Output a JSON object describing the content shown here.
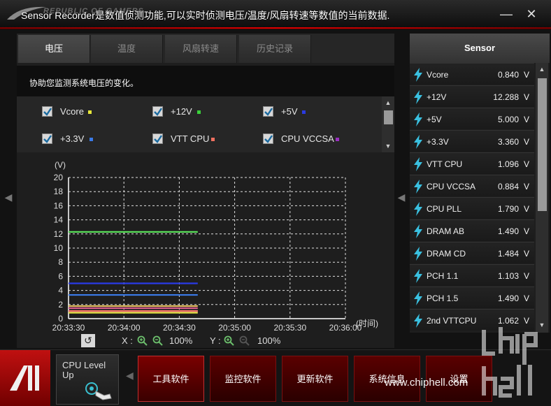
{
  "titlebar": {
    "logo_text": "REPUBLIC OF GAMERS",
    "title": "Sensor Recorder是数值侦测功能,可以实时侦测电压/温度/风扇转速等数值的当前数据.",
    "minimize": "—",
    "close": "✕"
  },
  "tabs": [
    {
      "label": "电压",
      "active": true
    },
    {
      "label": "温度",
      "active": false
    },
    {
      "label": "风扇转速",
      "active": false
    },
    {
      "label": "历史记录",
      "active": false
    }
  ],
  "description": "协助您监测系统电压的变化。",
  "checks": [
    {
      "label": "Vcore",
      "checked": true,
      "color": "#e8e83a"
    },
    {
      "label": "+12V",
      "checked": true,
      "color": "#3ad03a"
    },
    {
      "label": "+5V",
      "checked": true,
      "color": "#2a3ae0"
    },
    {
      "label": "+3.3V",
      "checked": true,
      "color": "#3a7ae8"
    },
    {
      "label": "VTT CPU",
      "checked": true,
      "color": "#f07060"
    },
    {
      "label": "CPU VCCSA",
      "checked": true,
      "color": "#9a30c0"
    }
  ],
  "chart_data": {
    "type": "line",
    "ylabel": "(V)",
    "xlabel": "(时间)",
    "ylim": [
      0,
      20
    ],
    "yticks": [
      0,
      2,
      4,
      6,
      8,
      10,
      12,
      14,
      16,
      18,
      20
    ],
    "xticks": [
      "20:33:30",
      "20:34:00",
      "20:34:30",
      "20:35:00",
      "20:35:30",
      "20:36:00"
    ],
    "x_range": [
      "20:33:30",
      "20:36:00"
    ],
    "grid": true,
    "series": [
      {
        "name": "+12V",
        "color": "#5ae05a",
        "x": [
          "20:33:30",
          "20:34:40"
        ],
        "y": [
          12.288,
          12.288
        ]
      },
      {
        "name": "+5V",
        "color": "#2a3ae8",
        "x": [
          "20:33:30",
          "20:34:40"
        ],
        "y": [
          5.0,
          5.0
        ]
      },
      {
        "name": "+3.3V",
        "color": "#3a7ae8",
        "x": [
          "20:33:30",
          "20:34:40"
        ],
        "y": [
          3.36,
          3.36
        ]
      },
      {
        "name": "CPU PLL",
        "color": "#e8c060",
        "x": [
          "20:33:30",
          "20:34:40"
        ],
        "y": [
          1.79,
          1.79
        ]
      },
      {
        "name": "DRAM AB",
        "color": "#e06090",
        "x": [
          "20:33:30",
          "20:34:40"
        ],
        "y": [
          1.49,
          1.49
        ]
      },
      {
        "name": "PCH 1.1",
        "color": "#d070d0",
        "x": [
          "20:33:30",
          "20:34:40"
        ],
        "y": [
          1.103,
          1.103
        ]
      },
      {
        "name": "VTT CPU",
        "color": "#f07060",
        "x": [
          "20:33:30",
          "20:34:40"
        ],
        "y": [
          1.096,
          1.096
        ]
      },
      {
        "name": "CPU VCCSA",
        "color": "#9a30c0",
        "x": [
          "20:33:30",
          "20:34:40"
        ],
        "y": [
          0.884,
          0.884
        ]
      },
      {
        "name": "Vcore",
        "color": "#e8e83a",
        "x": [
          "20:33:30",
          "20:34:40"
        ],
        "y": [
          0.84,
          0.84
        ]
      }
    ]
  },
  "zoom": {
    "reset_icon": "undo-icon",
    "x_label": "X :",
    "x_percent": "100%",
    "y_label": "Y :",
    "y_percent": "100%"
  },
  "sensor": {
    "header": "Sensor",
    "rows": [
      {
        "name": "Vcore",
        "value": "0.840",
        "unit": "V"
      },
      {
        "name": "+12V",
        "value": "12.288",
        "unit": "V"
      },
      {
        "name": "+5V",
        "value": "5.000",
        "unit": "V"
      },
      {
        "name": "+3.3V",
        "value": "3.360",
        "unit": "V"
      },
      {
        "name": "VTT CPU",
        "value": "1.096",
        "unit": "V"
      },
      {
        "name": "CPU VCCSA",
        "value": "0.884",
        "unit": "V"
      },
      {
        "name": "CPU PLL",
        "value": "1.790",
        "unit": "V"
      },
      {
        "name": "DRAM AB",
        "value": "1.490",
        "unit": "V"
      },
      {
        "name": "DRAM CD",
        "value": "1.484",
        "unit": "V"
      },
      {
        "name": "PCH 1.1",
        "value": "1.103",
        "unit": "V"
      },
      {
        "name": "PCH 1.5",
        "value": "1.490",
        "unit": "V"
      },
      {
        "name": "2nd VTTCPU",
        "value": "1.062",
        "unit": "V"
      }
    ]
  },
  "bottom": {
    "cpu_level_label": "CPU Level Up",
    "buttons": [
      "工具软件",
      "监控软件",
      "更新软件",
      "系统信息",
      "设置"
    ],
    "watermark": "www.chiphell.com"
  }
}
